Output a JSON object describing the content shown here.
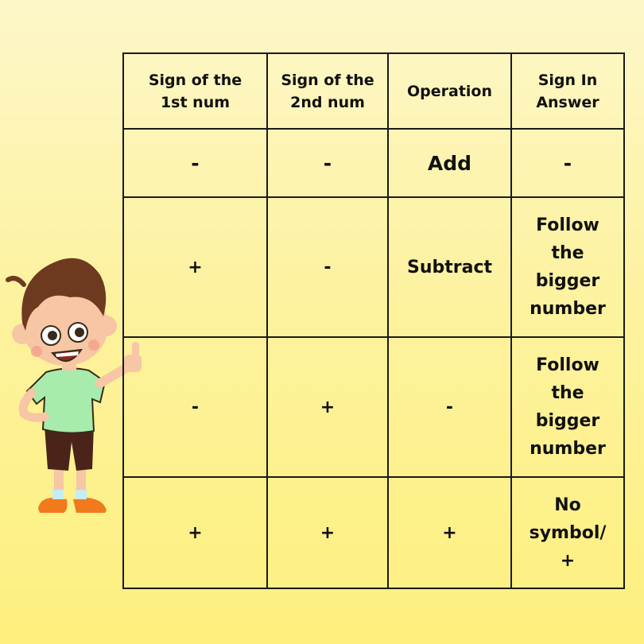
{
  "table": {
    "headers": [
      "Sign of the\n1st num",
      "Sign of the\n2nd num",
      "Operation",
      "Sign In\nAnswer"
    ],
    "rows": [
      [
        "-",
        "-",
        "Add",
        "-"
      ],
      [
        "+",
        "-",
        "Subtract",
        "Follow\nthe\nbigger\nnumber"
      ],
      [
        "-",
        "+",
        "-",
        "Follow\nthe\nbigger\nnumber"
      ],
      [
        "+",
        "+",
        "+",
        "No\nsymbol/\n+"
      ]
    ]
  },
  "illustration": {
    "icon": "cartoon-boy-thumbs-up-icon"
  },
  "colors": {
    "background": "#fdf3a6",
    "border": "#1a1a1a",
    "text": "#111111"
  }
}
